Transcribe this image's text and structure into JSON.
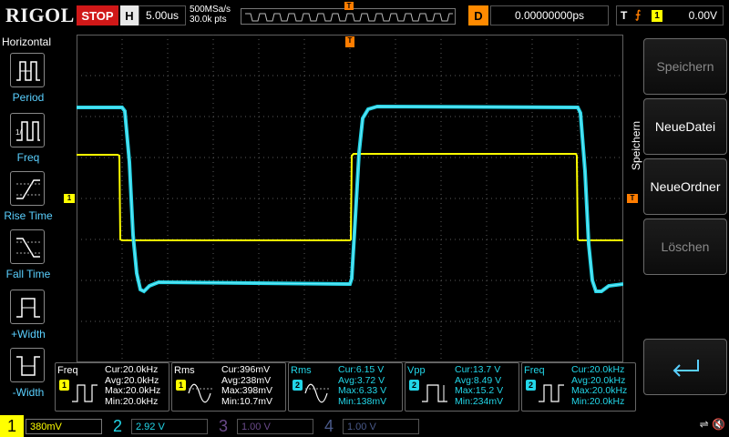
{
  "header": {
    "brand": "RIGOL",
    "run_state": "STOP",
    "timebase_label": "H",
    "timebase": "5.00us",
    "sample_rate": "500MSa/s",
    "mem_depth": "30.0k pts",
    "trigger_pos_marker": "T",
    "delay_label": "D",
    "delay": "0.00000000ps",
    "trigger_label": "T",
    "trigger_source": "1",
    "trigger_level": "0.00V"
  },
  "left_menu": {
    "title": "Horizontal",
    "items": [
      {
        "label": "Period",
        "icon": "period-icon"
      },
      {
        "label": "Freq",
        "icon": "frequency-icon"
      },
      {
        "label": "Rise Time",
        "icon": "rise-time-icon"
      },
      {
        "label": "Fall Time",
        "icon": "fall-time-icon"
      },
      {
        "label": "+Width",
        "icon": "positive-width-icon"
      },
      {
        "label": "-Width",
        "icon": "negative-width-icon"
      }
    ]
  },
  "right_menu": {
    "title": "Speichern",
    "softkeys": [
      {
        "label": "Speichern",
        "enabled": false
      },
      {
        "label": "NeueDatei",
        "enabled": true
      },
      {
        "label": "NeueOrdner",
        "enabled": true
      },
      {
        "label": "Löschen",
        "enabled": false
      }
    ],
    "enter_icon": "enter-icon"
  },
  "screen": {
    "ch1_marker": "1",
    "trigger_level_marker": "T",
    "trigger_top_marker": "T"
  },
  "measurements": [
    {
      "name": "Freq",
      "channel": "1",
      "cur": "Cur:20.0kHz",
      "avg": "Avg:20.0kHz",
      "max": "Max:20.0kHz",
      "min": "Min:20.0kHz"
    },
    {
      "name": "Rms",
      "channel": "1",
      "cur": "Cur:396mV",
      "avg": "Avg:238mV",
      "max": "Max:398mV",
      "min": "Min:10.7mV"
    },
    {
      "name": "Rms",
      "channel": "2",
      "cur": "Cur:6.15 V",
      "avg": "Avg:3.72 V",
      "max": "Max:6.33 V",
      "min": "Min:138mV"
    },
    {
      "name": "Vpp",
      "channel": "2",
      "cur": "Cur:13.7 V",
      "avg": "Avg:8.49 V",
      "max": "Max:15.2 V",
      "min": "Min:234mV"
    },
    {
      "name": "Freq",
      "channel": "2",
      "cur": "Cur:20.0kHz",
      "avg": "Avg:20.0kHz",
      "max": "Max:20.0kHz",
      "min": "Min:20.0kHz"
    }
  ],
  "channels": [
    {
      "num": "1",
      "scale": "380mV"
    },
    {
      "num": "2",
      "scale": "2.92 V"
    },
    {
      "num": "3",
      "scale": "1.00 V"
    },
    {
      "num": "4",
      "scale": "1.00 V"
    }
  ],
  "colors": {
    "ch1": "#ffff00",
    "ch2": "#22d6e8",
    "trigger": "#ff7d00",
    "stop": "#d01818"
  }
}
